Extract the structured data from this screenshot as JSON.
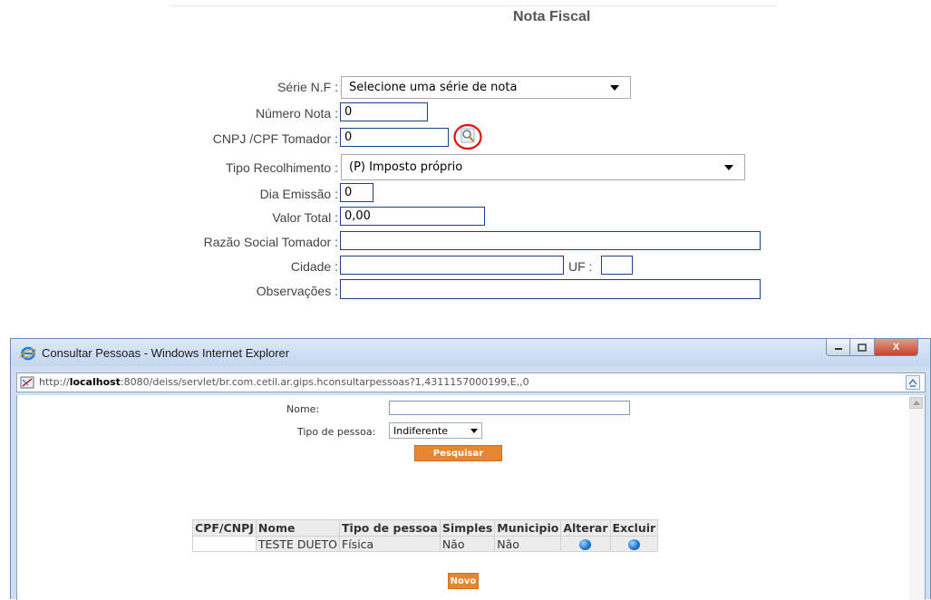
{
  "form": {
    "title": "Nota Fiscal",
    "fields": {
      "serie": {
        "label": "Série N.F :",
        "value": "Selecione uma série de nota"
      },
      "numero": {
        "label": "Número Nota :",
        "value": "0"
      },
      "cnpj": {
        "label": "CNPJ /CPF Tomador :",
        "value": "0"
      },
      "tipo_recolhimento": {
        "label": "Tipo Recolhimento :",
        "value": "(P) Imposto próprio"
      },
      "dia_emissao": {
        "label": "Dia Emissão :",
        "value": "0"
      },
      "valor_total": {
        "label": "Valor Total :",
        "value": "0,00"
      },
      "razao_social": {
        "label": "Razão Social Tomador :",
        "value": ""
      },
      "cidade": {
        "label": "Cidade :",
        "value": ""
      },
      "uf": {
        "label": "UF :",
        "value": ""
      },
      "observacoes": {
        "label": "Observações :",
        "value": ""
      }
    },
    "highlight_color": "#e01010",
    "lookup_icon": "magnifier-icon"
  },
  "popup": {
    "window_title": "Consultar Pessoas - Windows Internet Explorer",
    "window_buttons": {
      "minimize": "minimize-icon",
      "maximize": "maximize-icon",
      "close": "X"
    },
    "address": {
      "prefix": "http://",
      "host": "localhost",
      "rest": ":8080/deiss/servlet/br.com.cetil.ar.gips.hconsultarpessoas?1,4311157000199,E,,0"
    },
    "search": {
      "nome_label": "Nome:",
      "nome_value": "",
      "tipo_label": "Tipo de pessoa:",
      "tipo_value": "Indiferente",
      "button_label": "Pesquisar"
    },
    "table": {
      "headers": [
        "CPF/CNPJ",
        "Nome",
        "Tipo de pessoa",
        "Simples",
        "Municipio",
        "Alterar",
        "Excluir"
      ],
      "rows": [
        {
          "cpf": "",
          "nome": "TESTE DUETO",
          "tipo": "Física",
          "simples": "Não",
          "municipio": "Não",
          "alterar_icon": "globe-icon",
          "excluir_icon": "globe-icon"
        }
      ]
    },
    "novo_label": "Novo",
    "accent_color": "#e8852f"
  }
}
